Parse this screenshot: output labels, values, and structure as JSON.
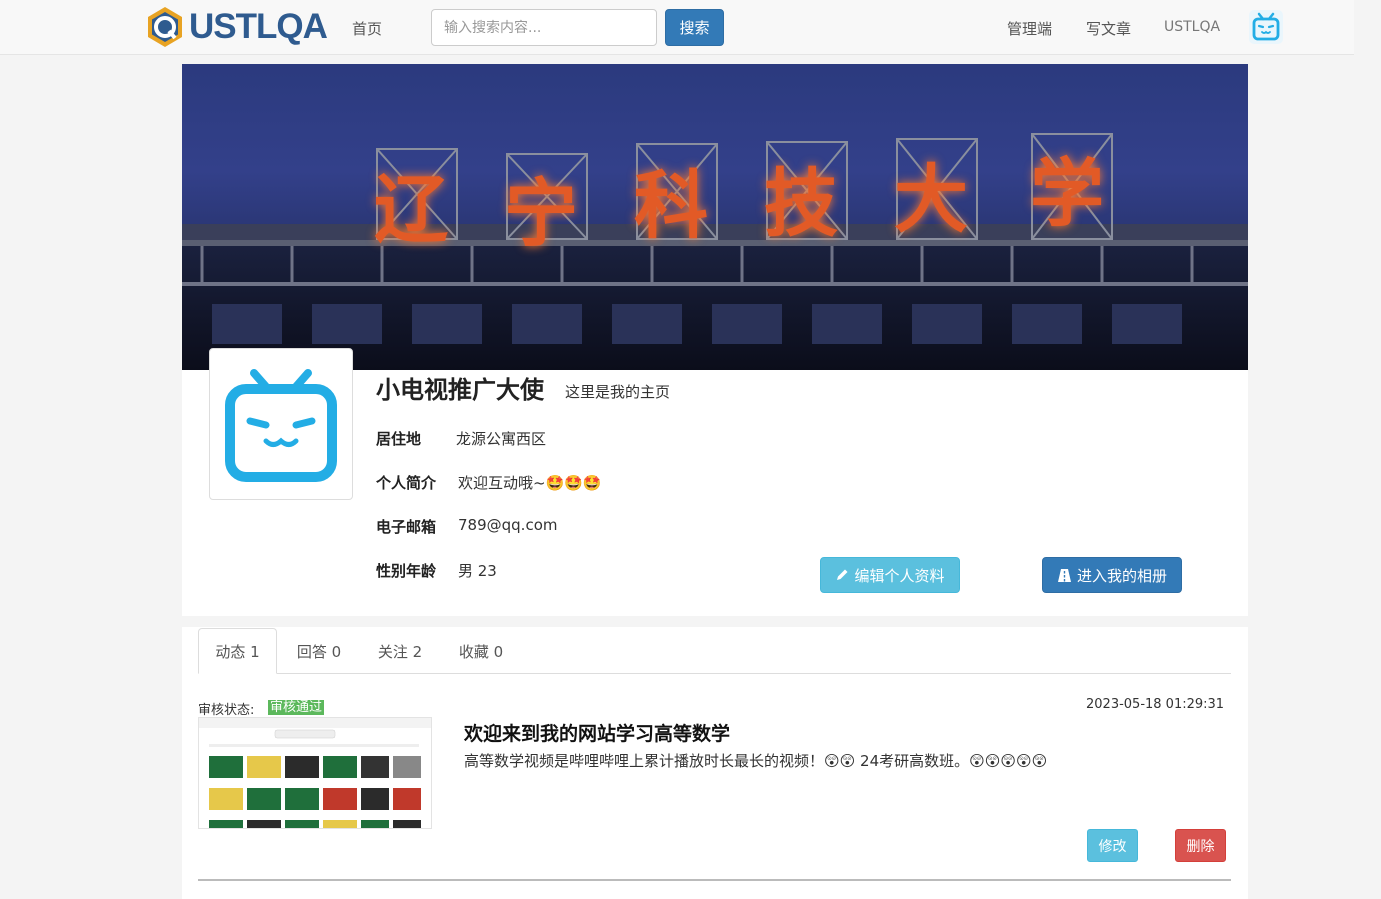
{
  "brand": {
    "name": "USTLQA",
    "accent": "#337ab7"
  },
  "nav": {
    "home": "首页",
    "search_placeholder": "输入搜索内容...",
    "search_button": "搜索",
    "admin": "管理端",
    "write": "写文章",
    "site": "USTLQA"
  },
  "banner": {
    "characters": [
      "辽",
      "宁",
      "科",
      "技",
      "大",
      "学"
    ]
  },
  "profile": {
    "name": "小电视推广大使",
    "tagline": "这里是我的主页",
    "fields": [
      {
        "label": "居住地",
        "value": "龙源公寓西区"
      },
      {
        "label": "个人简介",
        "value": "欢迎互动哦~🤩🤩🤩"
      },
      {
        "label": "电子邮箱",
        "value": "789@qq.com"
      },
      {
        "label": "性别年龄",
        "value": "男 23"
      }
    ],
    "edit_button": "编辑个人资料",
    "album_button": "进入我的相册"
  },
  "tabs": [
    {
      "label": "动态 1",
      "active": true
    },
    {
      "label": "回答 0",
      "active": false
    },
    {
      "label": "关注 2",
      "active": false
    },
    {
      "label": "收藏 0",
      "active": false
    }
  ],
  "post": {
    "status_label": "审核状态:",
    "status_value": "审核通过",
    "time": "2023-05-18 01:29:31",
    "title": "欢迎来到我的网站学习高等数学",
    "body": "高等数学视频是哔哩哔哩上累计播放时长最长的视频！😲😲 24考研高数班。😲😲😲😲😲",
    "modify_button": "修改",
    "delete_button": "删除"
  }
}
